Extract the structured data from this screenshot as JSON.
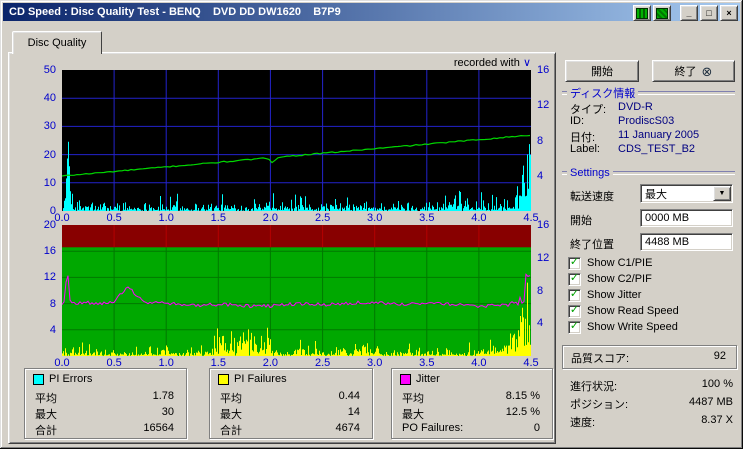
{
  "window": {
    "title": "CD Speed : Disc Quality Test - BENQ    DVD DD DW1620    B7P9",
    "controls": {
      "minimize": "_",
      "maximize": "□",
      "close": "×"
    }
  },
  "tab": {
    "label": "Disc Quality"
  },
  "chart_header": {
    "recorded_with": "recorded with"
  },
  "icons": {
    "exit": "⊗",
    "dropdown_arrow": "▼",
    "check": "✓",
    "chevron": "∨"
  },
  "colors": {
    "titlebar_left": "#0a246a",
    "titlebar_right": "#a6caf0",
    "axis_text": "#0000cc",
    "value_text": "#000080",
    "check_green": "#00a000"
  },
  "charts": {
    "top": {
      "bg": "#000000",
      "grid": "#2323cc",
      "x_min": 0,
      "x_max": 4.5,
      "left_axis": {
        "min": 0,
        "max": 50,
        "ticks": [
          "50",
          "40",
          "30",
          "20",
          "10",
          "0"
        ]
      },
      "right_axis": {
        "min": 0,
        "max": 16,
        "ticks": [
          "16",
          "12",
          "8",
          "4"
        ]
      },
      "x_ticks": [
        "0.0",
        "0.5",
        "1.0",
        "1.5",
        "2.0",
        "2.5",
        "3.0",
        "3.5",
        "4.0",
        "4.5"
      ],
      "series": {
        "pi_errors_color": "#00ffff",
        "speed_color": "#00d800"
      }
    },
    "bottom": {
      "bg": "#00a800",
      "grid": "#007800",
      "band_color": "#880000",
      "band_grid": "#b40000",
      "band_bottom_value": 16.6,
      "x_min": 0,
      "x_max": 4.5,
      "left_axis": {
        "min": 0,
        "max": 20,
        "ticks": [
          "20",
          "16",
          "12",
          "8",
          "4"
        ]
      },
      "right_axis": {
        "min": 0,
        "max": 16,
        "ticks": [
          "16",
          "12",
          "8",
          "4"
        ]
      },
      "x_ticks": [
        "0.0",
        "0.5",
        "1.0",
        "1.5",
        "2.0",
        "2.5",
        "3.0",
        "3.5",
        "4.0",
        "4.5"
      ],
      "series": {
        "pi_failures_color": "#ffff00",
        "jitter_color": "#ff00ff"
      }
    }
  },
  "legend": {
    "pi_errors": {
      "title": "PI Errors",
      "swatch": "#00ffff",
      "rows": [
        [
          "平均",
          "1.78"
        ],
        [
          "最大",
          "30"
        ],
        [
          "合計",
          "16564"
        ]
      ]
    },
    "pi_failures": {
      "title": "PI Failures",
      "swatch": "#ffff00",
      "rows": [
        [
          "平均",
          "0.44"
        ],
        [
          "最大",
          "14"
        ],
        [
          "合計",
          "4674"
        ]
      ]
    },
    "jitter": {
      "title": "Jitter",
      "swatch": "#ff00ff",
      "rows": [
        [
          "平均",
          "8.15 %"
        ],
        [
          "最大",
          "12.5 %"
        ],
        [
          "PO Failures:",
          "0"
        ]
      ]
    }
  },
  "panel": {
    "start_button": "開始",
    "exit_button": "終了",
    "disc_info": {
      "title": "ディスク情報",
      "rows": [
        [
          "タイプ:",
          "DVD-R"
        ],
        [
          "ID:",
          "ProdiscS03"
        ],
        [
          "日付:",
          "11 January 2005"
        ],
        [
          "Label:",
          "CDS_TEST_B2"
        ]
      ]
    },
    "settings": {
      "title": "Settings",
      "transfer_label": "転送速度",
      "transfer_value": "最大",
      "start_label": "開始",
      "start_value": "0000 MB",
      "end_label": "終了位置",
      "end_value": "4488 MB"
    },
    "checkboxes": [
      "Show C1/PIE",
      "Show C2/PIF",
      "Show Jitter",
      "Show Read Speed",
      "Show Write Speed"
    ],
    "quality": {
      "label": "品質スコア:",
      "value": "92"
    },
    "status": [
      [
        "進行状況:",
        "100 %"
      ],
      [
        "ポジション:",
        "4487 MB"
      ],
      [
        "速度:",
        "8.37 X"
      ]
    ]
  }
}
